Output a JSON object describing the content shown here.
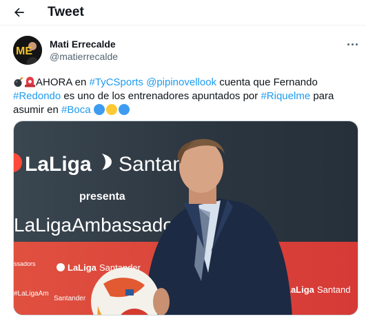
{
  "header": {
    "title": "Tweet",
    "back_icon": "arrow-left-icon"
  },
  "author": {
    "name": "Mati Errecalde",
    "handle": "@matierrecalde",
    "avatar_initials": "ME",
    "more_icon": "more-dots-icon"
  },
  "tweet": {
    "line1": {
      "bomb": "💣",
      "siren": "🚨",
      "t1": "AHORA en ",
      "h1": "#TyCSports",
      "t2": " ",
      "m1": "@pipinovellook",
      "t3": " cuenta que Fernando"
    },
    "line2": {
      "h1": "#Redondo",
      "t1": " es uno de los entrenadores apuntados por ",
      "h2": "#Riquelme",
      "t2": " para"
    },
    "line3": {
      "t1": "asumir en ",
      "h1": "#Boca"
    },
    "circles": [
      "#3d9cf0",
      "#fcc935",
      "#3d9cf0"
    ]
  },
  "media": {
    "banner_brand": "LaLiga",
    "banner_sponsor": "Santander",
    "banner_presenta": "presenta",
    "banner_ambassadors": "LaLigaAmbassadors",
    "strip_texts": [
      "ssadors",
      "LaLiga",
      "Santander",
      "#LaLigaAm",
      "Santander",
      "LaLiga",
      "Santand"
    ],
    "colors": {
      "wall": "#2c3640",
      "strip": "#d9453d",
      "suit": "#1c2a44"
    }
  }
}
